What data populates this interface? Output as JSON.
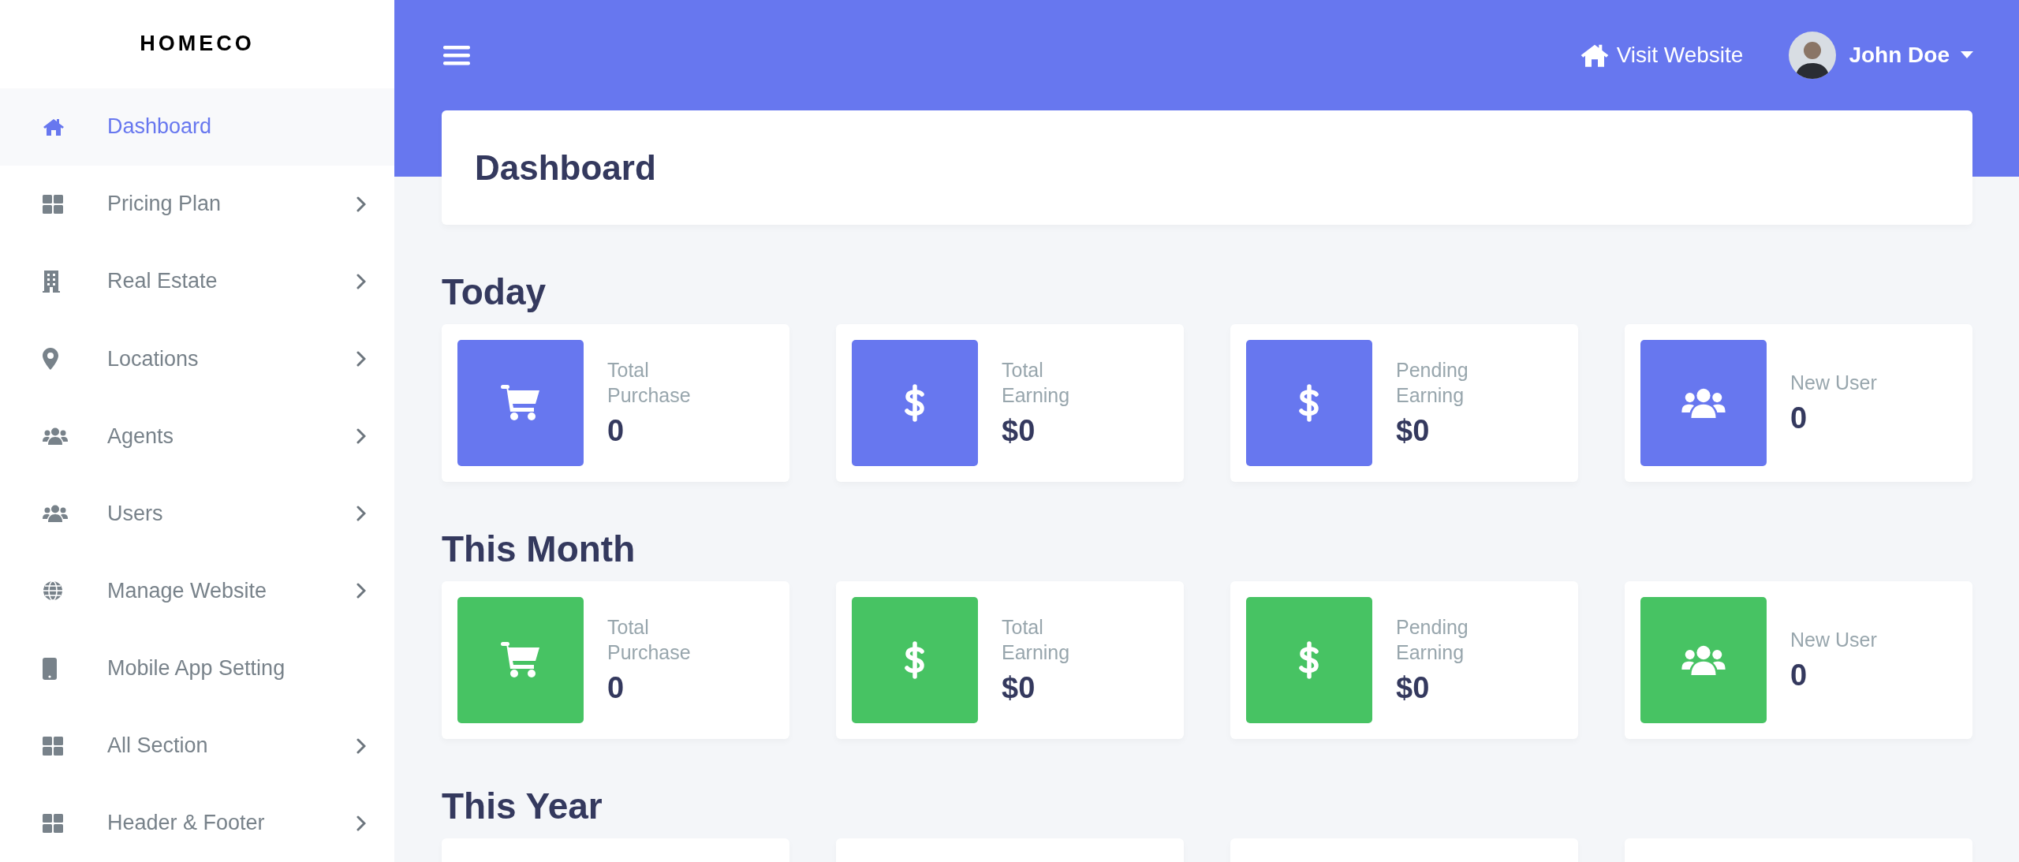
{
  "sidebar": {
    "logo": "HOMECO",
    "items": [
      {
        "kind": "home",
        "label": "Dashboard",
        "selected": true,
        "has_submenu": false
      },
      {
        "kind": "grid",
        "label": "Pricing Plan",
        "selected": false,
        "has_submenu": true
      },
      {
        "kind": "building",
        "label": "Real Estate",
        "selected": false,
        "has_submenu": true
      },
      {
        "kind": "pin",
        "label": "Locations",
        "selected": false,
        "has_submenu": true
      },
      {
        "kind": "users",
        "label": "Agents",
        "selected": false,
        "has_submenu": true
      },
      {
        "kind": "users",
        "label": "Users",
        "selected": false,
        "has_submenu": true
      },
      {
        "kind": "globe",
        "label": "Manage Website",
        "selected": false,
        "has_submenu": true
      },
      {
        "kind": "mobile",
        "label": "Mobile App Setting",
        "selected": false,
        "has_submenu": false
      },
      {
        "kind": "grid",
        "label": "All Section",
        "selected": false,
        "has_submenu": true
      },
      {
        "kind": "grid",
        "label": "Header & Footer",
        "selected": false,
        "has_submenu": true
      }
    ]
  },
  "topbar": {
    "visit_website": "Visit Website",
    "user_name": "John Doe"
  },
  "page_title": "Dashboard",
  "sections": [
    {
      "title": "Today",
      "stats": [
        {
          "kind": "cart",
          "color": "#6777ef",
          "label": "Total Purchase",
          "value": "0"
        },
        {
          "kind": "dollar",
          "color": "#6777ef",
          "label": "Total Earning",
          "value": "$0"
        },
        {
          "kind": "dollar",
          "color": "#6777ef",
          "label": "Pending Earning",
          "value": "$0"
        },
        {
          "kind": "users",
          "color": "#6777ef",
          "label": "New User",
          "value": "0"
        }
      ]
    },
    {
      "title": "This Month",
      "stats": [
        {
          "kind": "cart",
          "color": "#47c363",
          "label": "Total Purchase",
          "value": "0"
        },
        {
          "kind": "dollar",
          "color": "#47c363",
          "label": "Total Earning",
          "value": "$0"
        },
        {
          "kind": "dollar",
          "color": "#47c363",
          "label": "Pending Earning",
          "value": "$0"
        },
        {
          "kind": "users",
          "color": "#47c363",
          "label": "New User",
          "value": "0"
        }
      ]
    },
    {
      "title": "This Year"
    }
  ]
}
